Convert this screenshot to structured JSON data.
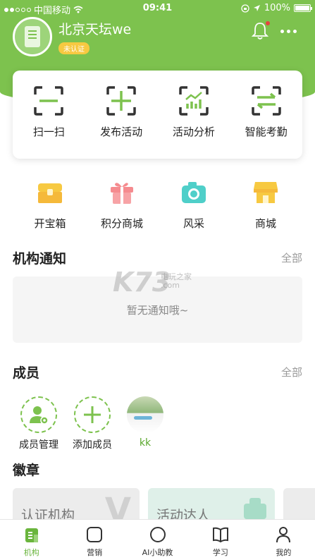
{
  "status_bar": {
    "carrier": "中国移动",
    "time": "09:41",
    "battery": "100%"
  },
  "colors": {
    "primary": "#7dc24e",
    "badge": "#f7c941",
    "icon_dark": "#333333",
    "accent": "#5aa82e"
  },
  "header": {
    "org_name": "北京天坛we",
    "cert_badge": "未认证",
    "bell_icon": "bell-icon",
    "more_icon": "more-dots-icon"
  },
  "quick_actions": [
    {
      "label": "扫一扫",
      "icon": "scan-icon"
    },
    {
      "label": "发布活动",
      "icon": "publish-plus-icon"
    },
    {
      "label": "活动分析",
      "icon": "chart-analysis-icon"
    },
    {
      "label": "智能考勤",
      "icon": "attendance-arrows-icon"
    }
  ],
  "features": [
    {
      "label": "开宝箱",
      "icon": "treasure-chest-icon"
    },
    {
      "label": "积分商城",
      "icon": "gift-icon"
    },
    {
      "label": "风采",
      "icon": "camera-icon"
    },
    {
      "label": "商城",
      "icon": "store-icon"
    }
  ],
  "notice": {
    "title": "机构通知",
    "more": "全部",
    "empty_text": "暂无通知哦~"
  },
  "members": {
    "title": "成员",
    "more": "全部",
    "items": [
      {
        "label": "成员管理",
        "icon": "member-manage-icon"
      },
      {
        "label": "添加成员",
        "icon": "add-member-icon"
      },
      {
        "label": "kk",
        "icon": "member-avatar"
      }
    ]
  },
  "badges": {
    "title": "徽章",
    "cards": [
      {
        "label": "认证机构"
      },
      {
        "label": "活动达人"
      }
    ]
  },
  "watermark": {
    "logo": "K73",
    "site_cn": "电玩之家",
    "site_url": ".com"
  },
  "tabbar": [
    {
      "label": "机构",
      "icon": "institution-icon",
      "active": true
    },
    {
      "label": "营销",
      "icon": "marketing-icon",
      "active": false
    },
    {
      "label": "AI小助教",
      "icon": "ai-assistant-icon",
      "active": false
    },
    {
      "label": "学习",
      "icon": "book-icon",
      "active": false
    },
    {
      "label": "我的",
      "icon": "profile-icon",
      "active": false
    }
  ]
}
